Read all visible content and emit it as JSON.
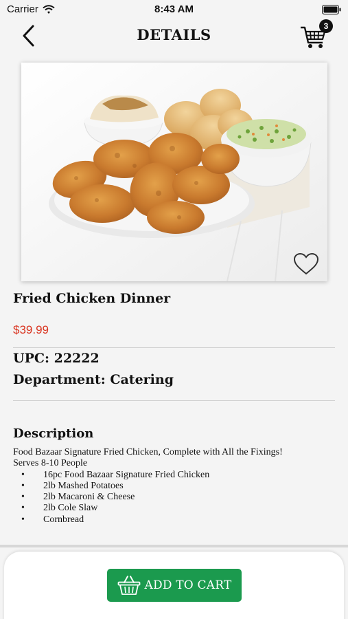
{
  "status_bar": {
    "carrier": "Carrier",
    "time": "8:43 AM"
  },
  "nav": {
    "title": "DETAILS",
    "cart_count": "3"
  },
  "product": {
    "name": "Fried Chicken Dinner",
    "price": "$39.99",
    "upc": "UPC: 22222",
    "department": "Department: Catering"
  },
  "description": {
    "title": "Description",
    "lines": [
      "Food Bazaar Signature Fried Chicken, Complete with All the Fixings!",
      "Serves 8-10 People"
    ],
    "items": [
      "16pc Food Bazaar Signature Fried Chicken",
      "2lb Mashed Potatoes",
      "2lb Macaroni & Cheese",
      "2lb Cole Slaw",
      "Cornbread"
    ]
  },
  "actions": {
    "add_to_cart": "ADD TO CART"
  },
  "colors": {
    "accent": "#1b9a4e",
    "price": "#d9331f"
  },
  "icons": {
    "back": "chevron-left-icon",
    "cart": "shopping-cart-icon",
    "favorite": "heart-outline-icon",
    "basket": "basket-icon"
  }
}
